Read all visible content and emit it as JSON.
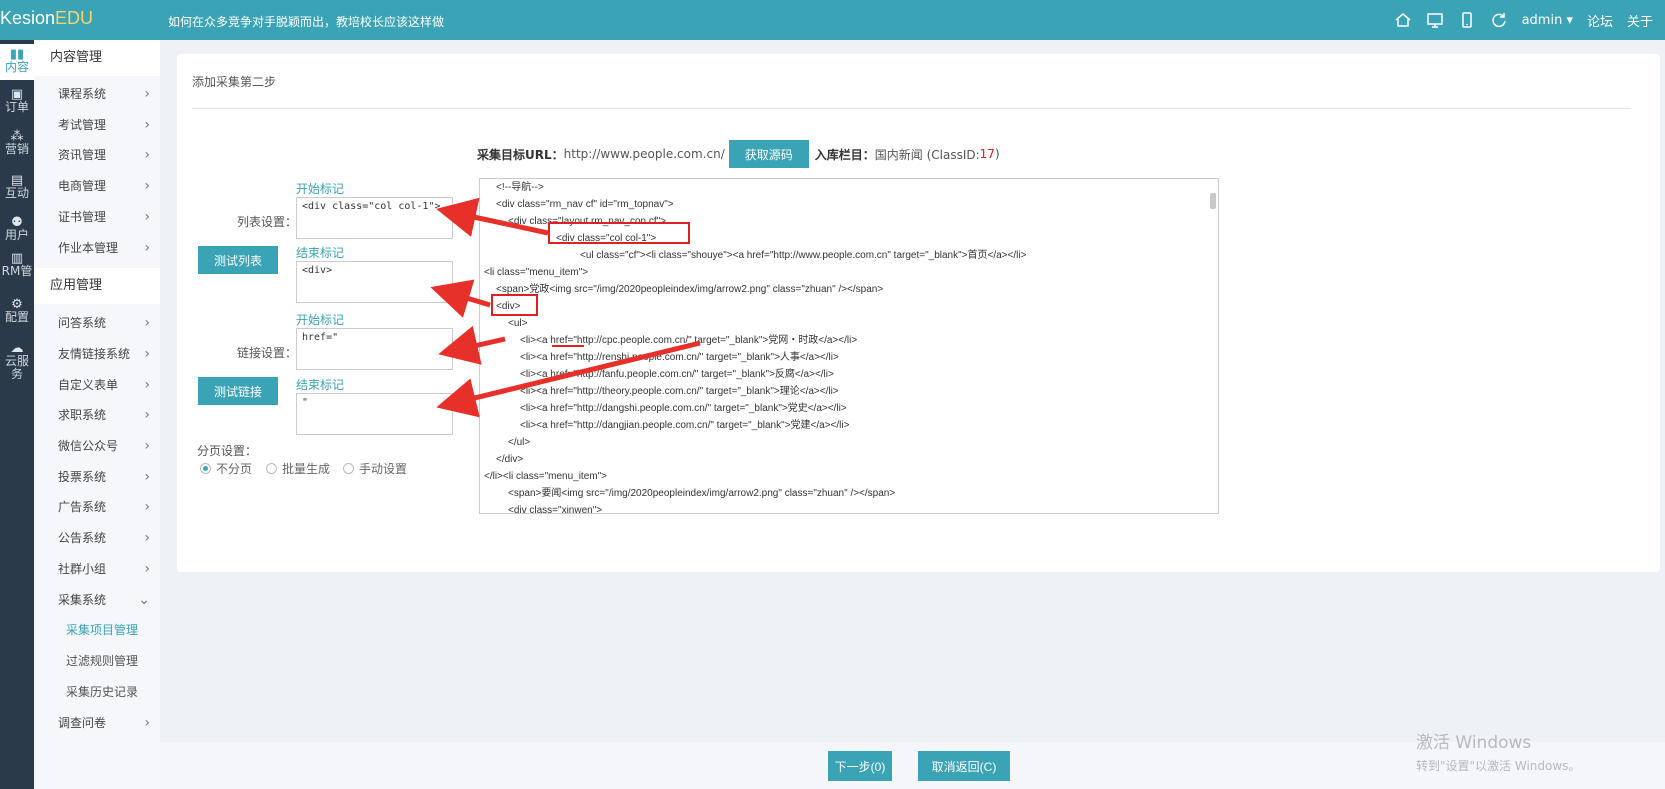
{
  "header": {
    "logo_main": "Kesion",
    "logo_accent": "EDU",
    "notice": "如何在众多竞争对手脱颖而出，教培校长应该这样做",
    "user": "admin ▾",
    "forum": "论坛",
    "about": "关于"
  },
  "iconbar": [
    {
      "label": "内容",
      "icon": "book-icon"
    },
    {
      "label": "订单",
      "icon": "order-icon"
    },
    {
      "label": "营销",
      "icon": "network-icon"
    },
    {
      "label": "互动",
      "icon": "chat-icon"
    },
    {
      "label": "用户",
      "icon": "user-icon"
    },
    {
      "label": "RM管",
      "icon": "crm-icon"
    },
    {
      "label": "配置",
      "icon": "gear-icon"
    },
    {
      "label": "云服务",
      "icon": "cloud-icon"
    }
  ],
  "menu": {
    "group1": "内容管理",
    "items1": [
      "课程系统",
      "考试管理",
      "资讯管理",
      "电商管理",
      "证书管理",
      "作业本管理"
    ],
    "group2": "应用管理",
    "items2": [
      "问答系统",
      "友情链接系统",
      "自定义表单",
      "求职系统",
      "微信公众号",
      "投票系统",
      "广告系统",
      "公告系统",
      "社群小组",
      "采集系统"
    ],
    "collect_subs": [
      "采集项目管理",
      "过滤规则管理",
      "采集历史记录"
    ],
    "last": "调查问卷"
  },
  "page": {
    "title": "添加采集第二步",
    "url_label": "采集目标URL：",
    "url_value": "http://www.people.com.cn/",
    "fetch_button": "获取源码",
    "column_label": "入库栏目：",
    "column_value": "国内新闻 (ClassID:",
    "class_id": "17",
    "column_close": ")",
    "list_setting": "列表设置：",
    "link_setting": "链接设置：",
    "start_mark": "开始标记",
    "end_mark": "结束标记",
    "list_start_value": "<div class=\"col col-1\">",
    "list_end_value": "<div>",
    "link_start_value": "href=\"",
    "link_end_value": "\"",
    "test_list_button": "测试列表",
    "test_link_button": "测试链接",
    "paging_label": "分页设置：",
    "paging_options": [
      "不分页",
      "批量生成",
      "手动设置"
    ],
    "paging_selected": 0
  },
  "source_lines": [
    "<!--导航-->",
    "<div class=\"rm_nav cf\" id=\"rm_topnav\">",
    "<div class=\"layout rm_nav_con cf\">",
    "<div class=\"col col-1\">",
    "<ul class=\"cf\"><li class=\"shouye\"><a href=\"http://www.people.com.cn\" target=\"_blank\">首页</a></li>",
    "<li class=\"menu_item\">",
    "<span>党政<img src=\"/img/2020peopleindex/img/arrow2.png\" class=\"zhuan\" /></span>",
    "<div>",
    "<ul>",
    "<li><a href=\"http://cpc.people.com.cn/\" target=\"_blank\">党网・时政</a></li>",
    "<li><a href=\"http://renshi.people.com.cn/\" target=\"_blank\">人事</a></li>",
    "<li><a href=\"http://fanfu.people.com.cn/\" target=\"_blank\">反腐</a></li>",
    "<li><a href=\"http://theory.people.com.cn/\" target=\"_blank\">理论</a></li>",
    "<li><a href=\"http://dangshi.people.com.cn/\" target=\"_blank\">党史</a></li>",
    "<li><a href=\"http://dangjian.people.com.cn/\" target=\"_blank\">党建</a></li>",
    "</ul>",
    "</div>",
    "</li><li class=\"menu_item\">",
    "<span>要闻<img src=\"/img/2020peopleindex/img/arrow2.png\" class=\"zhuan\" /></span>",
    "<div class=\"xinwen\">"
  ],
  "footer": {
    "next_button": "下一步(0)",
    "cancel_button": "取消返回(C)"
  },
  "watermark": {
    "line1": "激活 Windows",
    "line2": "转到\"设置\"以激活 Windows。"
  }
}
